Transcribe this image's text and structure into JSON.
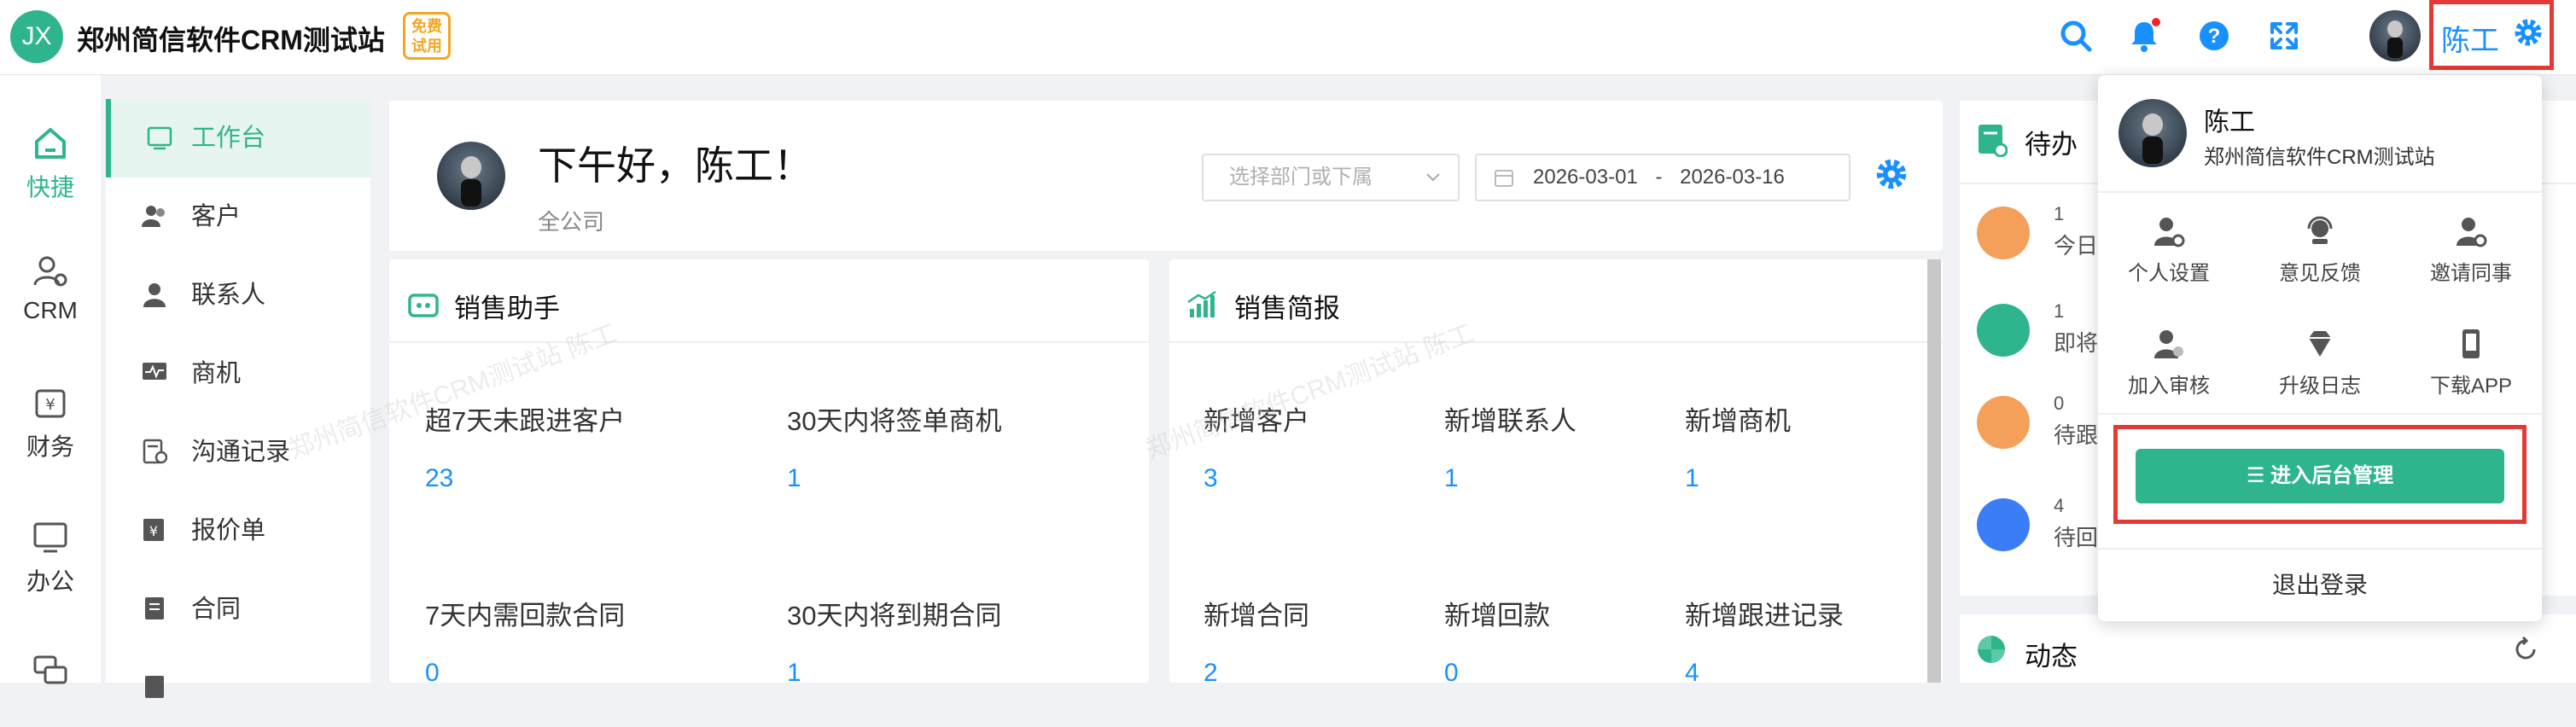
{
  "app": {
    "logo_text": "JX",
    "title": "郑州简信软件CRM测试站",
    "trial_badge": [
      "免费",
      "试用"
    ]
  },
  "topbar": {
    "icons": [
      "search-icon",
      "bell-icon",
      "help-icon",
      "fullscreen-icon"
    ],
    "user_name": "陈工"
  },
  "sidebar_primary": [
    {
      "label": "快捷",
      "icon": "home-icon",
      "active": true
    },
    {
      "label": "CRM",
      "icon": "user-gear-icon",
      "active": false
    },
    {
      "label": "财务",
      "icon": "wallet-icon",
      "active": false
    },
    {
      "label": "办公",
      "icon": "monitor-icon",
      "active": false
    }
  ],
  "sidebar_secondary": [
    {
      "label": "工作台",
      "icon": "dashboard-icon",
      "active": true
    },
    {
      "label": "客户",
      "icon": "customers-icon"
    },
    {
      "label": "联系人",
      "icon": "contact-icon"
    },
    {
      "label": "商机",
      "icon": "opportunity-icon"
    },
    {
      "label": "沟通记录",
      "icon": "record-icon"
    },
    {
      "label": "报价单",
      "icon": "quote-icon"
    },
    {
      "label": "合同",
      "icon": "contract-icon"
    }
  ],
  "welcome": {
    "greeting": "下午好，陈工！",
    "scope": "全公司",
    "dept_placeholder": "选择部门或下属",
    "date_start": "2026-03-01",
    "date_sep": "-",
    "date_end": "2026-03-16"
  },
  "sales_assistant": {
    "title": "销售助手",
    "stats": [
      {
        "label": "超7天未跟进客户",
        "value": "23"
      },
      {
        "label": "30天内将签单商机",
        "value": "1"
      },
      {
        "label": "7天内需回款合同",
        "value": "0"
      },
      {
        "label": "30天内将到期合同",
        "value": "1"
      }
    ]
  },
  "sales_brief": {
    "title": "销售简报",
    "stats": [
      {
        "label": "新增客户",
        "value": "3"
      },
      {
        "label": "新增联系人",
        "value": "1"
      },
      {
        "label": "新增商机",
        "value": "1"
      },
      {
        "label": "新增合同",
        "value": "2"
      },
      {
        "label": "新增回款",
        "value": "0"
      },
      {
        "label": "新增跟进记录",
        "value": "4"
      }
    ]
  },
  "watermark_text": "郑州简信软件CRM测试站 陈工",
  "todo": {
    "title": "待办",
    "items": [
      {
        "count": "1",
        "text": "今日需",
        "color": "#f5a05a"
      },
      {
        "count": "1",
        "text": "即将到",
        "color": "#2fb58d"
      },
      {
        "count": "0",
        "text": "待跟进",
        "color": "#f5a05a"
      },
      {
        "count": "4",
        "text": "待回款",
        "color": "#3b7df5"
      }
    ]
  },
  "activity": {
    "title": "动态"
  },
  "user_menu": {
    "name": "陈工",
    "company": "郑州简信软件CRM测试站",
    "items": [
      {
        "label": "个人设置",
        "icon": "user-settings-icon"
      },
      {
        "label": "意见反馈",
        "icon": "feedback-icon"
      },
      {
        "label": "邀请同事",
        "icon": "invite-icon"
      },
      {
        "label": "加入审核",
        "icon": "join-review-icon"
      },
      {
        "label": "升级日志",
        "icon": "upgrade-log-icon"
      },
      {
        "label": "下载APP",
        "icon": "download-app-icon"
      }
    ],
    "admin_button": "☰ 进入后台管理",
    "logout": "退出登录"
  },
  "colors": {
    "accent": "#2fb58d",
    "link": "#1890ff",
    "highlight_border": "#e53935",
    "badge": "#f5a623"
  }
}
